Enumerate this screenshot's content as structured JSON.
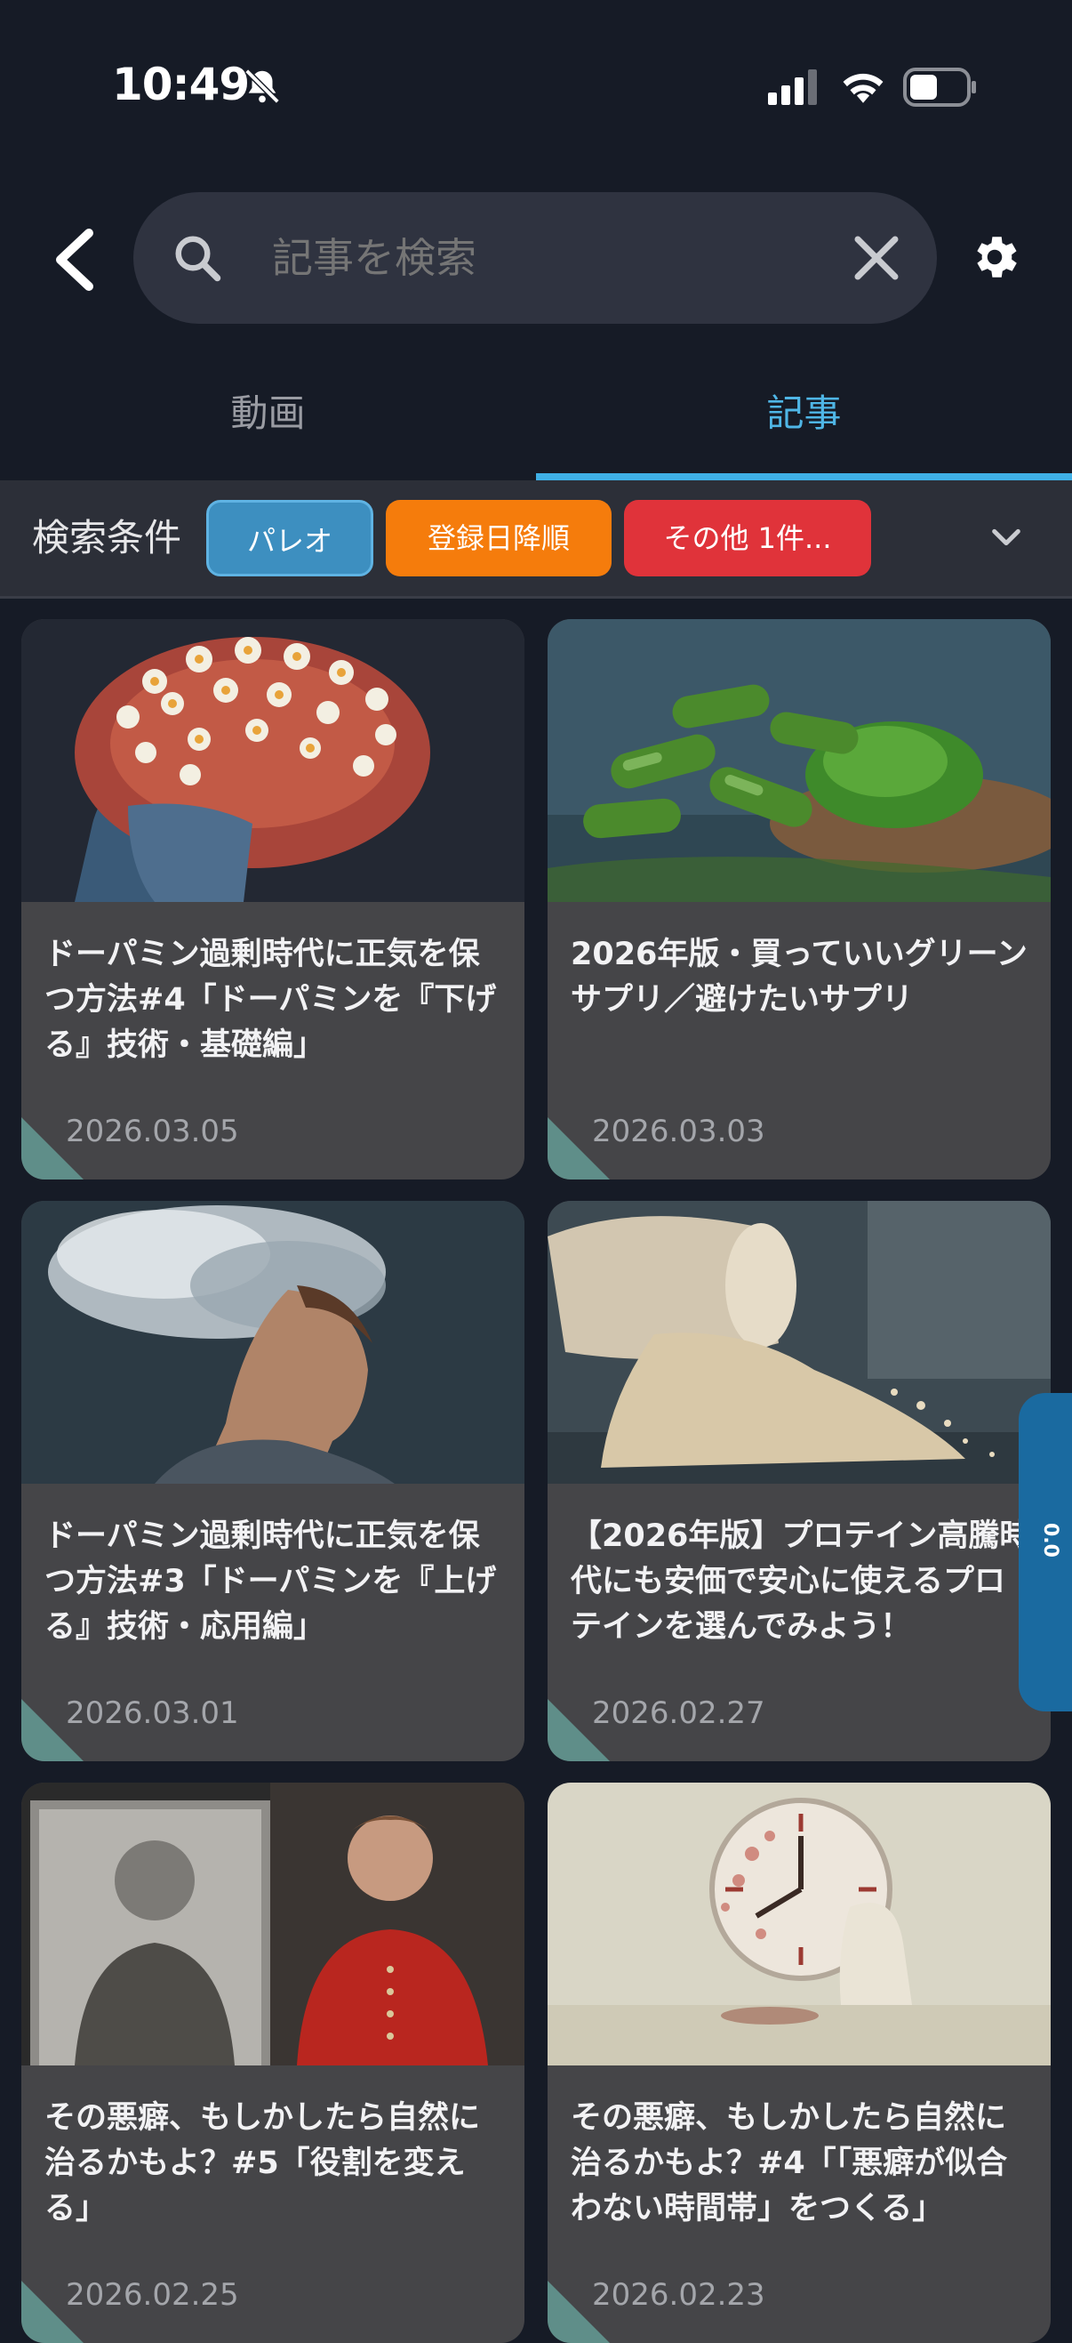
{
  "status_bar": {
    "time": "10:49"
  },
  "header": {
    "search_placeholder": "記事を検索"
  },
  "tabs": [
    {
      "label": "動画",
      "active": false
    },
    {
      "label": "記事",
      "active": true
    }
  ],
  "filters": {
    "label": "検索条件",
    "chips": [
      "パレオ",
      "登録日降順",
      "その他 1件..."
    ]
  },
  "articles": [
    {
      "title": "ドーパミン過剰時代に正気を保つ方法#4「ドーパミンを『下げる』技術・基礎編」",
      "date": "2026.03.05"
    },
    {
      "title": "2026年版・買っていいグリーンサプリ／避けたいサプリ",
      "date": "2026.03.03"
    },
    {
      "title": "ドーパミン過剰時代に正気を保つ方法#3「ドーパミンを『上げる』技術・応用編」",
      "date": "2026.03.01"
    },
    {
      "title": "【2026年版】プロテイン高騰時代にも安価で安心に使えるプロテインを選んでみよう！",
      "date": "2026.02.27"
    },
    {
      "title": "その悪癖、もしかしたら自然に治るかもよ？#5「役割を変える」",
      "date": "2026.02.25"
    },
    {
      "title": "その悪癖、もしかしたら自然に治るかもよ？#4「「悪癖が似合わない時間帯」をつくる」",
      "date": "2026.02.23"
    }
  ],
  "side_tab": {
    "label": "0.0"
  },
  "colors": {
    "background": "#161b26",
    "accent": "#3fb0e6",
    "chip_blue": "#3d8fc0",
    "chip_orange": "#f57c0c",
    "chip_red": "#e0333a",
    "card": "#454548"
  }
}
